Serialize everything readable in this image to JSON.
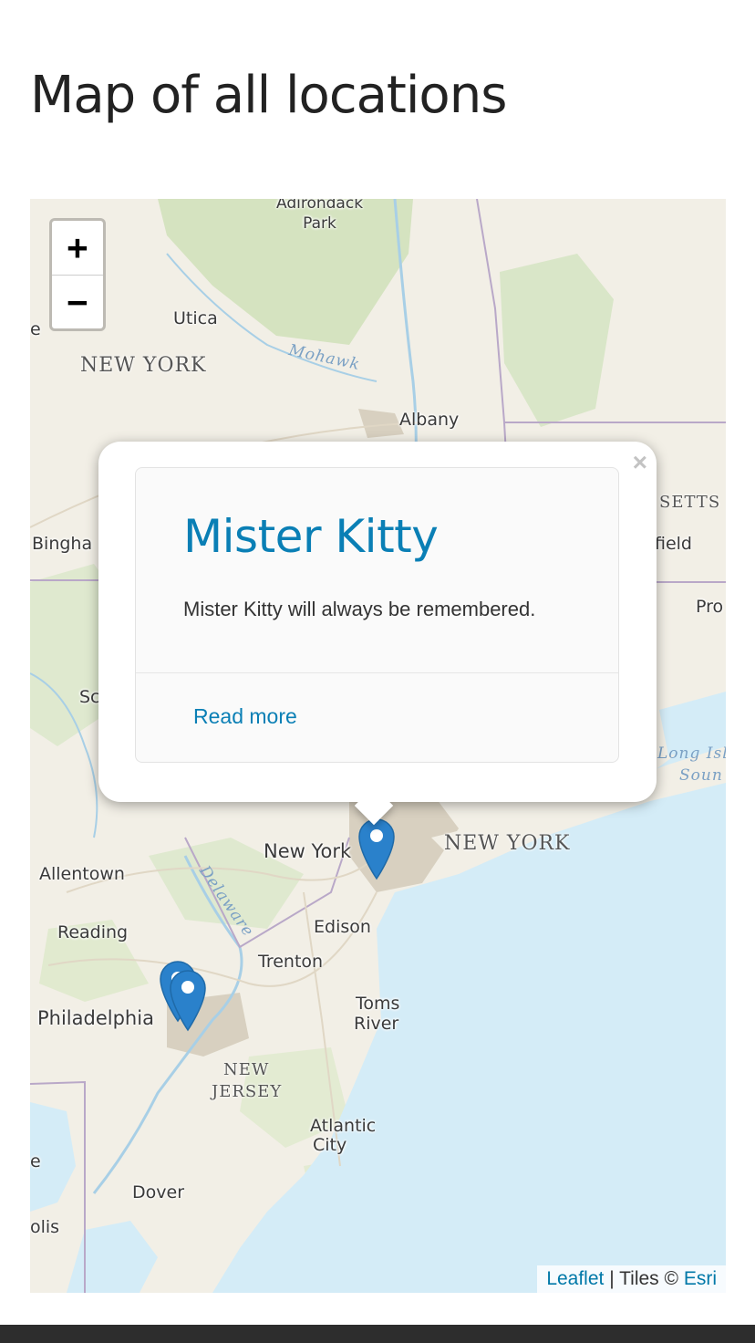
{
  "page": {
    "title": "Map of all locations"
  },
  "map": {
    "zoom_in_label": "+",
    "zoom_out_label": "−",
    "attribution": {
      "leaflet": "Leaflet",
      "tiles_text": " | Tiles © ",
      "esri": "Esri"
    },
    "labels": {
      "park": "Adirondack\nPark",
      "utica": "Utica",
      "e_left": "e",
      "ny_state": "NEW YORK",
      "mohawk": "Mohawk",
      "albany": "Albany",
      "setts": "SETTS",
      "bingha": "Bingha",
      "field": "field",
      "pro": "Pro",
      "sc": "Sc",
      "long_isl": "Long Isl",
      "soun": "Soun",
      "new_york_city": "New York",
      "ny_state_east": "NEW YORK",
      "allentown": "Allentown",
      "delaware": "Delaware",
      "reading": "Reading",
      "edison": "Edison",
      "trenton": "Trenton",
      "philadelphia": "Philadelphia",
      "toms": "Toms",
      "river": "River",
      "nj_new": "NEW",
      "nj_jersey": "JERSEY",
      "atlantic": "Atlantic",
      "city": "City",
      "e_left2": "e",
      "dover": "Dover",
      "olis": "olis"
    },
    "colors": {
      "water": "#d4ecf7",
      "land": "#f2efe6",
      "forest": "#d7e4c4",
      "urban": "#d9d2c3",
      "marker": "#2a81cb"
    }
  },
  "popup": {
    "close_label": "×",
    "title": "Mister Kitty",
    "text": "Mister Kitty will always be remembered.",
    "link": "Read more"
  }
}
